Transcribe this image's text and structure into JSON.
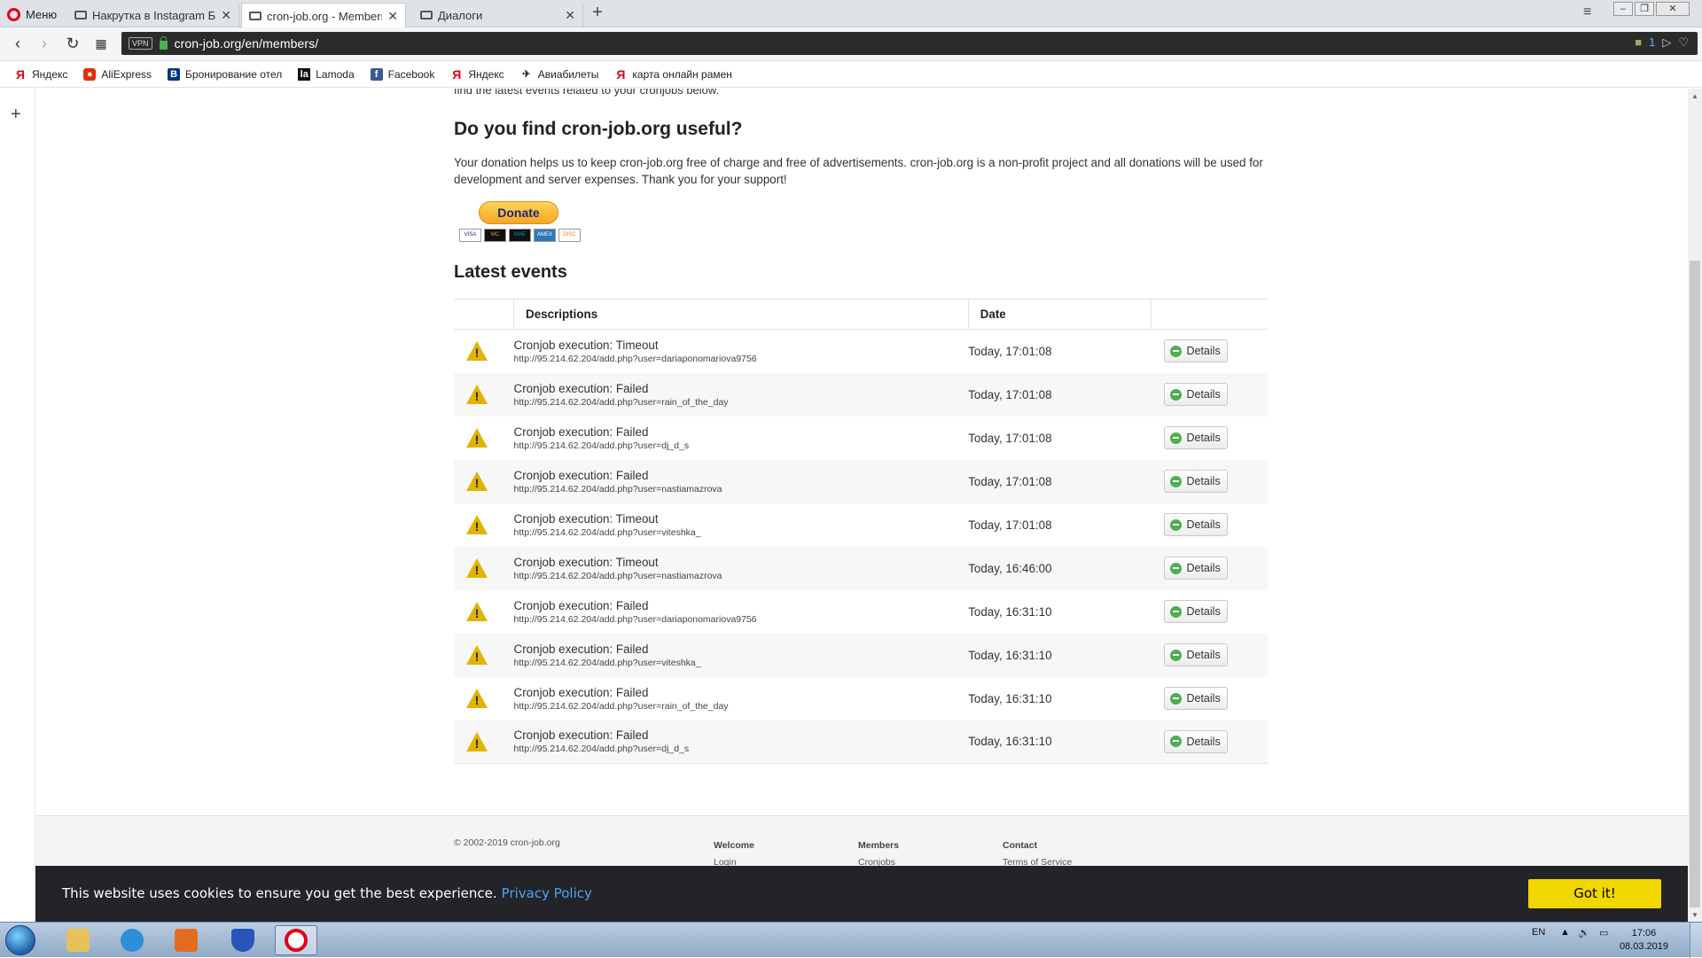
{
  "browser": {
    "menu_label": "Меню",
    "tabs": [
      {
        "label": "Накрутка в Instagram БЕС",
        "close": "✕"
      },
      {
        "label": "cron-job.org - Members",
        "close": "✕"
      },
      {
        "label": "Диалоги",
        "close": "✕"
      }
    ],
    "new_tab": "+",
    "url": "cron-job.org/en/members/",
    "vpn": "VPN",
    "badge_count": "1",
    "bookmarks": [
      {
        "label": "Яндекс",
        "icon": "yandex-icon"
      },
      {
        "label": "AliExpress",
        "icon": "aliexpress-icon"
      },
      {
        "label": "Бронирование отел",
        "icon": "booking-icon"
      },
      {
        "label": "Lamoda",
        "icon": "lamoda-icon"
      },
      {
        "label": "Facebook",
        "icon": "facebook-icon"
      },
      {
        "label": "Яндекс",
        "icon": "yandex-icon"
      },
      {
        "label": "Авиабилеты",
        "icon": "plane-icon"
      },
      {
        "label": "карта онлайн рамен",
        "icon": "yandex-icon"
      }
    ]
  },
  "page": {
    "intro_text": "find the latest events related to your cronjobs below.",
    "donate_heading": "Do you find cron-job.org useful?",
    "donate_text": "Your donation helps us to keep cron-job.org free of charge and free of advertisements. cron-job.org is a non-profit project and all donations will be used for development and server expenses. Thank you for your support!",
    "donate_button": "Donate",
    "cards": [
      "VISA",
      "MC",
      "MAE",
      "AMEX",
      "DISC"
    ],
    "events_heading": "Latest events",
    "table": {
      "headers": [
        "",
        "Descriptions",
        "Date",
        ""
      ],
      "details_label": "Details",
      "rows": [
        {
          "title": "Cronjob execution: Timeout",
          "url": "http://95.214.62.204/add.php?user=dariaponomariova9756",
          "date": "Today, 17:01:08"
        },
        {
          "title": "Cronjob execution: Failed",
          "url": "http://95.214.62.204/add.php?user=rain_of_the_day",
          "date": "Today, 17:01:08"
        },
        {
          "title": "Cronjob execution: Failed",
          "url": "http://95.214.62.204/add.php?user=dj_d_s",
          "date": "Today, 17:01:08"
        },
        {
          "title": "Cronjob execution: Failed",
          "url": "http://95.214.62.204/add.php?user=nastiamazrova",
          "date": "Today, 17:01:08"
        },
        {
          "title": "Cronjob execution: Timeout",
          "url": "http://95.214.62.204/add.php?user=viteshka_",
          "date": "Today, 17:01:08"
        },
        {
          "title": "Cronjob execution: Timeout",
          "url": "http://95.214.62.204/add.php?user=nastiamazrova",
          "date": "Today, 16:46:00"
        },
        {
          "title": "Cronjob execution: Failed",
          "url": "http://95.214.62.204/add.php?user=dariaponomariova9756",
          "date": "Today, 16:31:10"
        },
        {
          "title": "Cronjob execution: Failed",
          "url": "http://95.214.62.204/add.php?user=viteshka_",
          "date": "Today, 16:31:10"
        },
        {
          "title": "Cronjob execution: Failed",
          "url": "http://95.214.62.204/add.php?user=rain_of_the_day",
          "date": "Today, 16:31:10"
        },
        {
          "title": "Cronjob execution: Failed",
          "url": "http://95.214.62.204/add.php?user=dj_d_s",
          "date": "Today, 16:31:10"
        }
      ]
    },
    "footer": {
      "copyright": "© 2002-2019 cron-job.org",
      "cols": [
        {
          "heading": "Welcome",
          "link": "Login"
        },
        {
          "heading": "Members",
          "link": "Cronjobs"
        },
        {
          "heading": "Contact",
          "link": "Terms of Service"
        }
      ]
    },
    "cookie": {
      "message": "This website uses cookies to ensure you get the best experience.",
      "link": "Privacy Policy",
      "button": "Got it!"
    }
  },
  "taskbar": {
    "lang": "EN",
    "time": "17:06",
    "date": "08.03.2019"
  },
  "colors": {
    "accent_yellow": "#f1d600",
    "warning": "#e2b400",
    "cookie_bg": "#222428",
    "link_blue": "#4fa3f7"
  }
}
